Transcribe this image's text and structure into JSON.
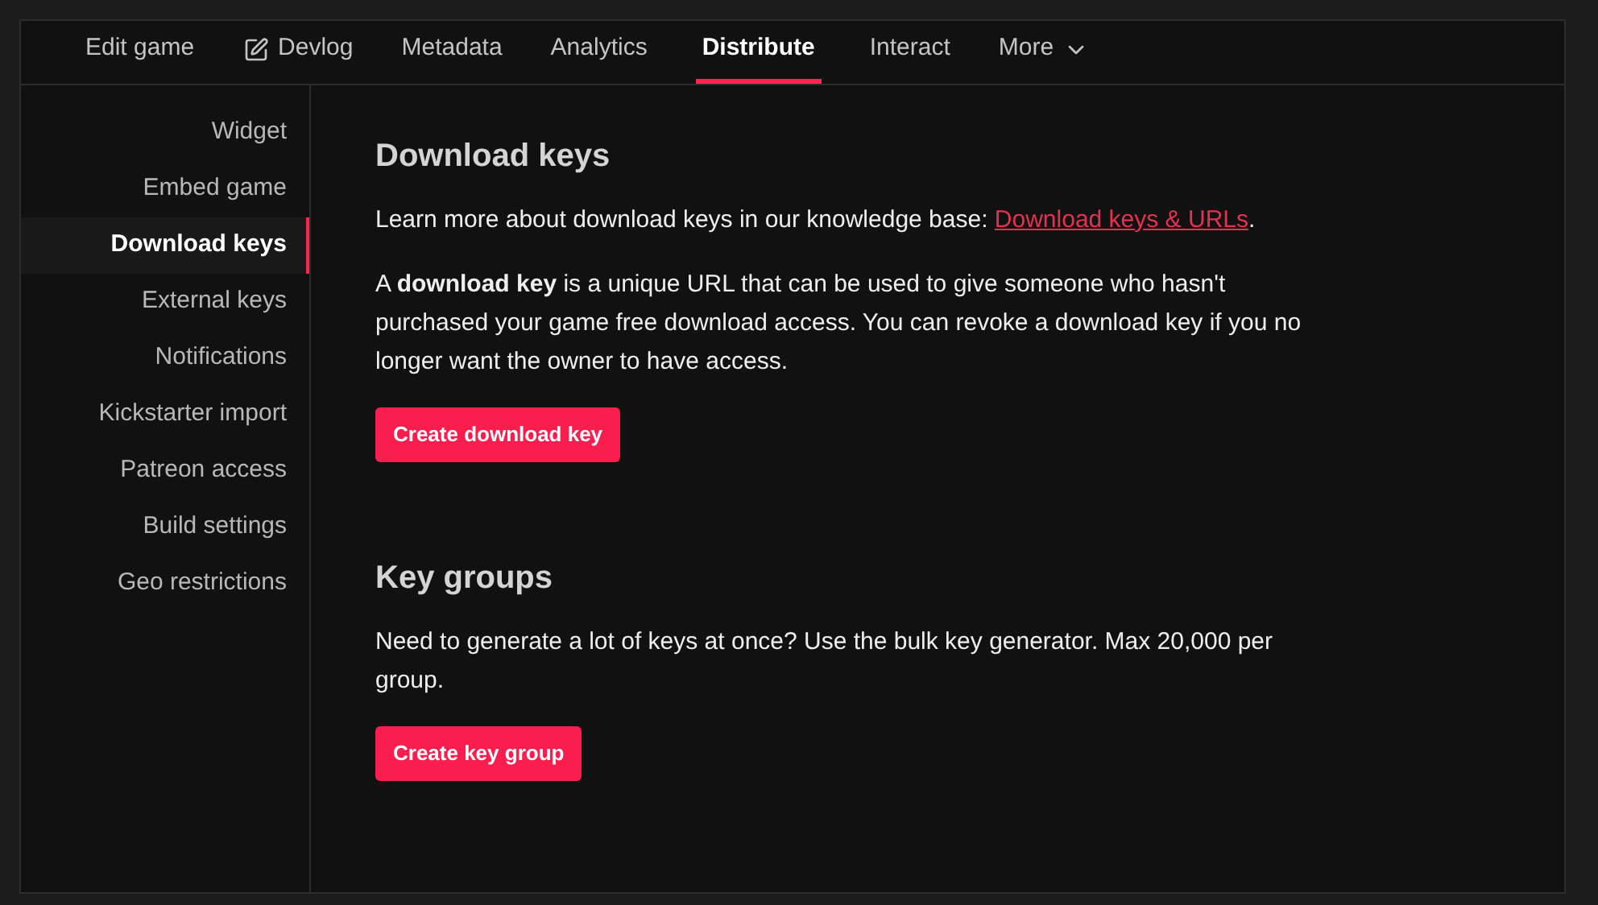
{
  "tabs": [
    {
      "label": "Edit game",
      "selected": false,
      "kind": "plain"
    },
    {
      "label": "Devlog",
      "selected": false,
      "kind": "edit"
    },
    {
      "label": "Metadata",
      "selected": false,
      "kind": "plain"
    },
    {
      "label": "Analytics",
      "selected": false,
      "kind": "plain"
    },
    {
      "label": "Distribute",
      "selected": true,
      "kind": "plain"
    },
    {
      "label": "Interact",
      "selected": false,
      "kind": "plain"
    },
    {
      "label": "More",
      "selected": false,
      "kind": "menu"
    }
  ],
  "sidebar": {
    "items": [
      {
        "label": "Widget",
        "selected": false
      },
      {
        "label": "Embed game",
        "selected": false
      },
      {
        "label": "Download keys",
        "selected": true
      },
      {
        "label": "External keys",
        "selected": false
      },
      {
        "label": "Notifications",
        "selected": false
      },
      {
        "label": "Kickstarter import",
        "selected": false
      },
      {
        "label": "Patreon access",
        "selected": false
      },
      {
        "label": "Build settings",
        "selected": false
      },
      {
        "label": "Geo restrictions",
        "selected": false
      }
    ]
  },
  "sections": [
    {
      "title": "Download keys",
      "paragraphs": [
        {
          "text": "Learn more about download keys in our knowledge base: ",
          "link": "Download keys & URLs",
          "after": "."
        },
        {
          "text": "A **download key** is a unique URL that can be used to give someone who hasn't purchased your game free download access. You can revoke a download key if you no longer want the owner to have access."
        }
      ],
      "button": "Create download key"
    },
    {
      "title": "Key groups",
      "paragraphs": [
        {
          "text": "Need to generate a lot of keys at once? Use the bulk key generator. Max 20,000 per group."
        }
      ],
      "button": "Create key group"
    }
  ]
}
